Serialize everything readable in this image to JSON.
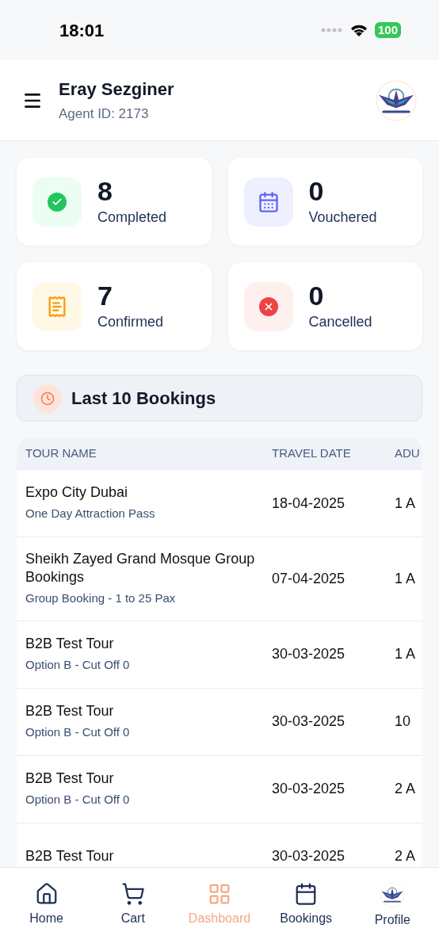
{
  "status_bar": {
    "time": "18:01",
    "battery": "100"
  },
  "header": {
    "name": "Eray Sezginer",
    "agent_id": "Agent ID: 2173"
  },
  "stats": [
    {
      "kind": "completed",
      "value": "8",
      "label": "Completed",
      "color": "#22c55e"
    },
    {
      "kind": "vouchered",
      "value": "0",
      "label": "Vouchered",
      "color": "#6366f1"
    },
    {
      "kind": "confirmed",
      "value": "7",
      "label": "Confirmed",
      "color": "#f59e0b"
    },
    {
      "kind": "cancelled",
      "value": "0",
      "label": "Cancelled",
      "color": "#ef4444"
    }
  ],
  "section": {
    "title": "Last 10 Bookings"
  },
  "table": {
    "columns": [
      "TOUR NAME",
      "TRAVEL DATE",
      "ADU"
    ],
    "rows": [
      {
        "tour": "Expo City Dubai",
        "option": "One Day Attraction Pass",
        "date": "18-04-2025",
        "column_3": "1 A"
      },
      {
        "tour": "Sheikh Zayed Grand Mosque Group Bookings",
        "option": "Group Booking - 1 to 25 Pax",
        "date": "07-04-2025",
        "column_3": "1 A"
      },
      {
        "tour": "B2B Test Tour",
        "option": "Option B - Cut Off 0",
        "date": "30-03-2025",
        "column_3": "1 A"
      },
      {
        "tour": "B2B Test Tour",
        "option": "Option B - Cut Off 0",
        "date": "30-03-2025",
        "column_3": "10"
      },
      {
        "tour": "B2B Test Tour",
        "option": "Option B - Cut Off 0",
        "date": "30-03-2025",
        "column_3": "2 A"
      },
      {
        "tour": "B2B Test Tour",
        "date": "30-03-2025",
        "column_3": "2 A"
      }
    ]
  },
  "nav": [
    {
      "kind": "home",
      "label": "Home",
      "selected": false
    },
    {
      "kind": "cart",
      "label": "Cart",
      "selected": false
    },
    {
      "kind": "dashboard",
      "label": "Dashboard",
      "selected": true
    },
    {
      "kind": "bookings",
      "label": "Bookings",
      "selected": false
    },
    {
      "kind": "profile",
      "label": "Profile",
      "selected": false
    }
  ]
}
